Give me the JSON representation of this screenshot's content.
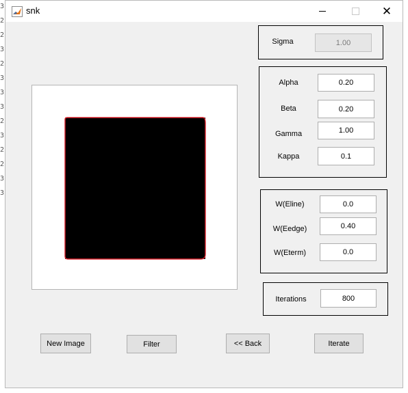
{
  "window": {
    "title": "snk"
  },
  "titlebar": {
    "minimize_icon": "minimize-icon",
    "maximize_icon": "maximize-icon",
    "close_icon": "close-icon",
    "close_glyph": "✕"
  },
  "gutter_chars": [
    "3",
    "2",
    "2",
    "3",
    "2",
    "3",
    "3:",
    "3",
    "2",
    "3",
    "2",
    "2",
    "3",
    "3"
  ],
  "sigma_panel": {
    "label": "Sigma",
    "value": "1.00"
  },
  "params_panel": {
    "alpha": {
      "label": "Alpha",
      "value": "0.20"
    },
    "beta": {
      "label": "Beta",
      "value": "0.20"
    },
    "gamma": {
      "label": "Gamma",
      "value": "1.00"
    },
    "kappa": {
      "label": "Kappa",
      "value": "0.1"
    }
  },
  "weights_panel": {
    "eline": {
      "label": "W(Eline)",
      "value": "0.0"
    },
    "eedge": {
      "label": "W(Eedge)",
      "value": "0.40"
    },
    "eterm": {
      "label": "W(Eterm)",
      "value": "0.0"
    }
  },
  "iterations_panel": {
    "label": "Iterations",
    "value": "800"
  },
  "buttons": {
    "new_image": "New Image",
    "filter": "Filter",
    "back": "<< Back",
    "iterate": "Iterate"
  },
  "colors": {
    "contour": "#d9212a",
    "square": "#000000",
    "window_bg": "#f0f0f0"
  }
}
